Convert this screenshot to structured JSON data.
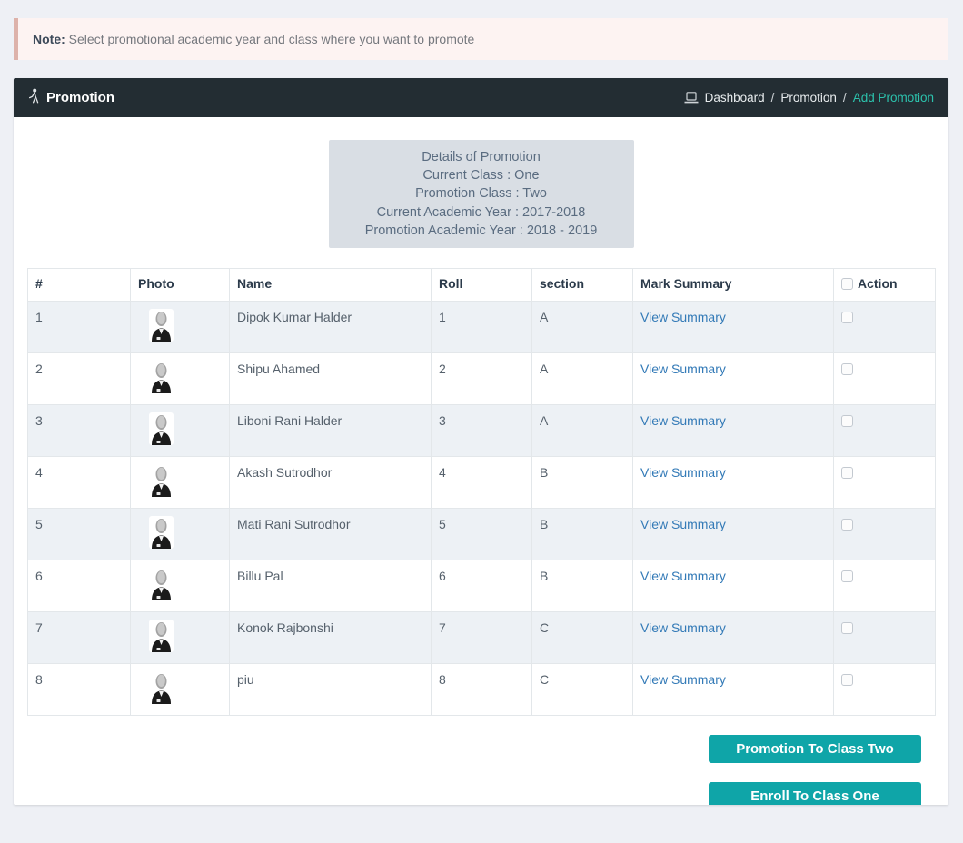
{
  "note": {
    "label": "Note:",
    "text": " Select promotional academic year and class where you want to promote"
  },
  "panel": {
    "title": "Promotion",
    "breadcrumb": {
      "separator": "/",
      "items": [
        {
          "label": "Dashboard",
          "active": false
        },
        {
          "label": "Promotion",
          "active": false
        },
        {
          "label": "Add Promotion",
          "active": true
        }
      ]
    }
  },
  "details": {
    "lines": [
      "Details of Promotion",
      "Current Class : One",
      "Promotion Class : Two",
      "Current Academic Year : 2017-2018",
      "Promotion Academic Year : 2018 - 2019"
    ]
  },
  "table": {
    "headers": [
      "#",
      "Photo",
      "Name",
      "Roll",
      "section",
      "Mark Summary",
      "Action"
    ],
    "mark_summary_link": "View Summary",
    "rows": [
      {
        "num": "1",
        "name": "Dipok Kumar Halder",
        "roll": "1",
        "section": "A"
      },
      {
        "num": "2",
        "name": "Shipu Ahamed",
        "roll": "2",
        "section": "A"
      },
      {
        "num": "3",
        "name": "Liboni Rani Halder",
        "roll": "3",
        "section": "A"
      },
      {
        "num": "4",
        "name": "Akash Sutrodhor",
        "roll": "4",
        "section": "B"
      },
      {
        "num": "5",
        "name": "Mati Rani Sutrodhor",
        "roll": "5",
        "section": "B"
      },
      {
        "num": "6",
        "name": "Billu Pal",
        "roll": "6",
        "section": "B"
      },
      {
        "num": "7",
        "name": "Konok Rajbonshi",
        "roll": "7",
        "section": "C"
      },
      {
        "num": "8",
        "name": "piu",
        "roll": "8",
        "section": "C"
      }
    ]
  },
  "actions": {
    "promote_button": "Promotion To Class Two",
    "enroll_button": "Enroll To Class One"
  },
  "colors": {
    "button_teal": "#0fa5a8",
    "breadcrumb_active": "#2cc2ad",
    "link_blue": "#337ab7",
    "note_border": "#ddb2aa",
    "note_background": "#fdf3f2",
    "panel_header": "#232d33",
    "details_background": "#d9dee4",
    "row_alt_background": "#edf1f5",
    "page_background": "#eef0f5"
  }
}
